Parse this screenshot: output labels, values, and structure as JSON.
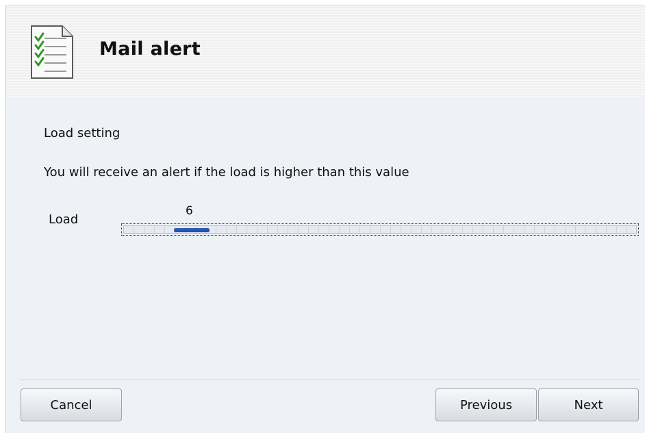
{
  "header": {
    "title": "Mail alert",
    "icon": "checklist-document-icon"
  },
  "content": {
    "section_title": "Load setting",
    "description": "You will receive an alert if the load is higher than this value",
    "load": {
      "label": "Load",
      "value": "6"
    }
  },
  "buttons": {
    "cancel": "Cancel",
    "previous": "Previous",
    "next": "Next"
  },
  "colors": {
    "accent": "#2b58b8",
    "background": "#eef1f6"
  }
}
